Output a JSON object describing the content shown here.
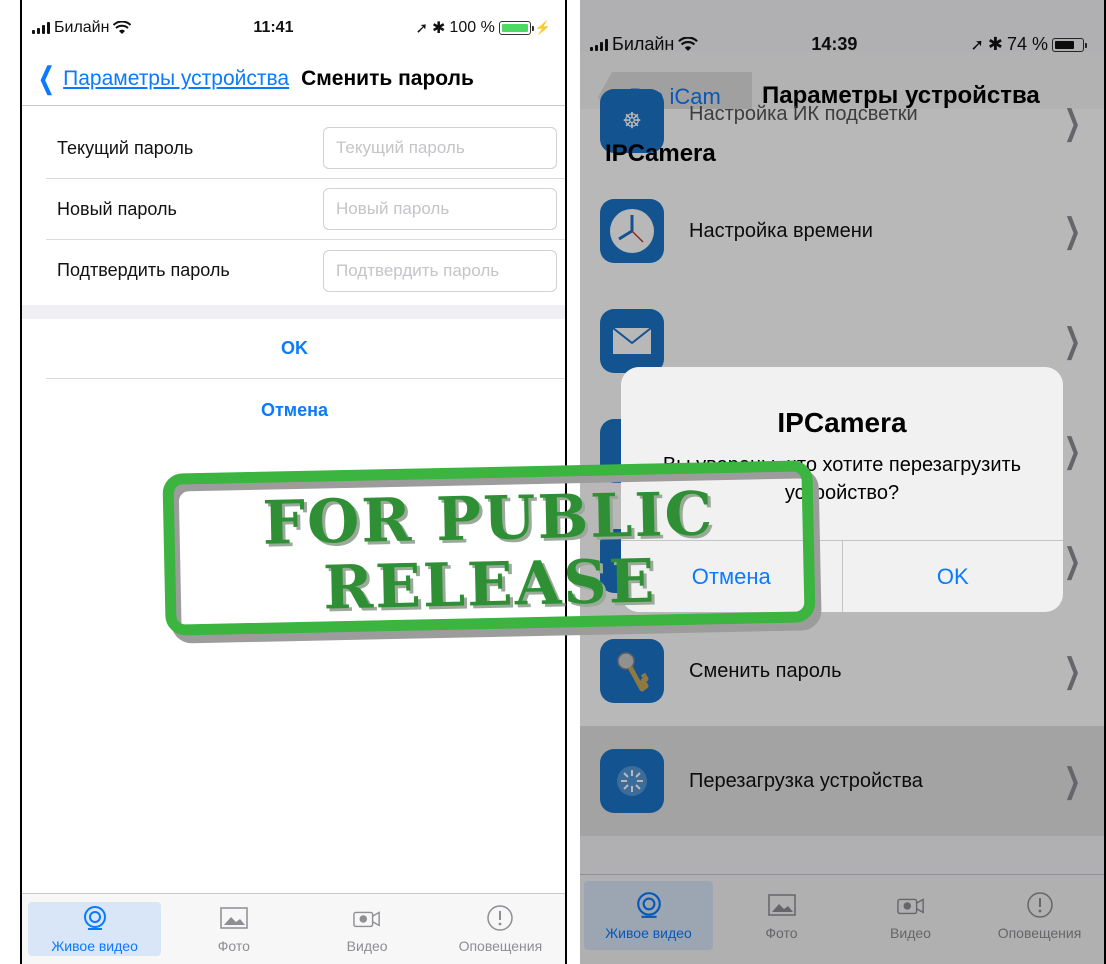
{
  "background_watermark": {
    "color": "#4f86c6"
  },
  "left_screen": {
    "status": {
      "carrier": "Билайн",
      "time": "11:41",
      "battery": "100 %",
      "battery_fill": 1.0
    },
    "nav": {
      "back_label": "Параметры устройства",
      "title": "Сменить пароль"
    },
    "form": [
      {
        "label": "Текущий пароль",
        "placeholder": "Текущий пароль"
      },
      {
        "label": "Новый пароль",
        "placeholder": "Новый пароль"
      },
      {
        "label": "Подтвердить пароль",
        "placeholder": "Подтвердить пароль"
      }
    ],
    "ok_label": "OK",
    "cancel_label": "Отмена",
    "tabs": [
      {
        "label": "Живое видео",
        "icon": "live-video-icon",
        "active": true
      },
      {
        "label": "Фото",
        "icon": "photo-icon",
        "active": false
      },
      {
        "label": "Видео",
        "icon": "video-icon",
        "active": false
      },
      {
        "label": "Оповещения",
        "icon": "alert-icon",
        "active": false
      }
    ]
  },
  "right_screen": {
    "status": {
      "carrier": "Билайн",
      "time": "14:39",
      "battery": "74 %",
      "battery_fill": 0.74
    },
    "nav": {
      "back_label": "Pro iCam",
      "title": "Параметры устройства"
    },
    "section_header": "IPCamera",
    "items": [
      {
        "label": "Настройка ИК подсветки",
        "icon": "ir-icon"
      },
      {
        "label": "Настройка времени",
        "icon": "clock-icon"
      },
      {
        "label": "",
        "icon": "mail-icon"
      },
      {
        "label": "",
        "icon": "settings-icon"
      },
      {
        "label": "",
        "icon": "storage-icon"
      },
      {
        "label": "Сменить пароль",
        "icon": "key-icon"
      },
      {
        "label": "Перезагрузка устройства",
        "icon": "reboot-icon"
      }
    ],
    "alert": {
      "title": "IPCamera",
      "message": "Вы уверены, что хотите перезагрузить устройство?",
      "cancel_label": "Отмена",
      "ok_label": "OK"
    },
    "tabs": [
      {
        "label": "Живое видео",
        "icon": "live-video-icon",
        "active": true
      },
      {
        "label": "Фото",
        "icon": "photo-icon",
        "active": false
      },
      {
        "label": "Видео",
        "icon": "video-icon",
        "active": false
      },
      {
        "label": "Оповещения",
        "icon": "alert-icon",
        "active": false
      }
    ]
  },
  "stamp": {
    "line1": "FOR PUBLIC",
    "line2": "RELEASE",
    "color": "#3bb440"
  }
}
